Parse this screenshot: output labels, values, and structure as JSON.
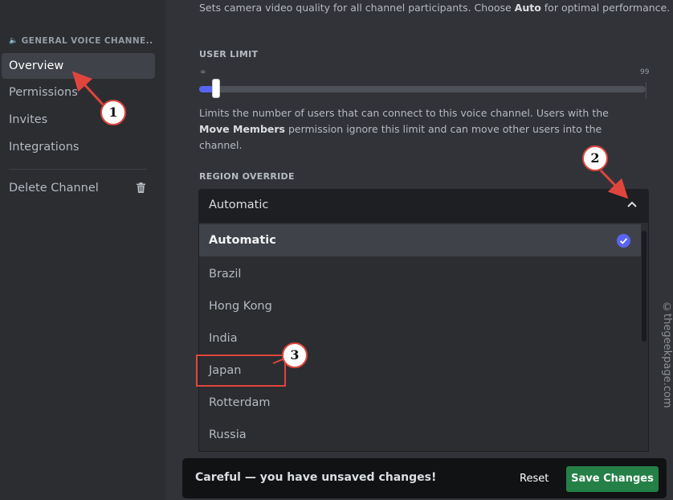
{
  "sidebar": {
    "header": "GENERAL VOICE CHANNE...",
    "items": [
      {
        "label": "Overview"
      },
      {
        "label": "Permissions"
      },
      {
        "label": "Invites"
      },
      {
        "label": "Integrations"
      }
    ],
    "delete_label": "Delete Channel"
  },
  "video_quality": {
    "description_pre": "Sets camera video quality for all channel participants. Choose ",
    "description_bold": "Auto",
    "description_post": " for optimal performance."
  },
  "user_limit": {
    "label": "USER LIMIT",
    "min_label": "∞",
    "max_label": "99",
    "value_fraction": 0.0,
    "description_pre": "Limits the number of users that can connect to this voice channel. Users with the ",
    "description_bold": "Move Members",
    "description_post": " permission ignore this limit and can move other users into the channel."
  },
  "region_override": {
    "label": "REGION OVERRIDE",
    "selected": "Automatic",
    "options": [
      {
        "label": "Automatic"
      },
      {
        "label": "Brazil"
      },
      {
        "label": "Hong Kong"
      },
      {
        "label": "India"
      },
      {
        "label": "Japan"
      },
      {
        "label": "Rotterdam"
      },
      {
        "label": "Russia"
      }
    ]
  },
  "notice": {
    "message": "Careful — you have unsaved changes!",
    "reset_label": "Reset",
    "save_label": "Save Changes"
  },
  "annotations": {
    "step1": "1",
    "step2": "2",
    "step3": "3"
  },
  "watermark": "©thegeekpage.com",
  "colors": {
    "accent": "#5865f2",
    "save": "#248046",
    "annotation": "#e0453d"
  }
}
